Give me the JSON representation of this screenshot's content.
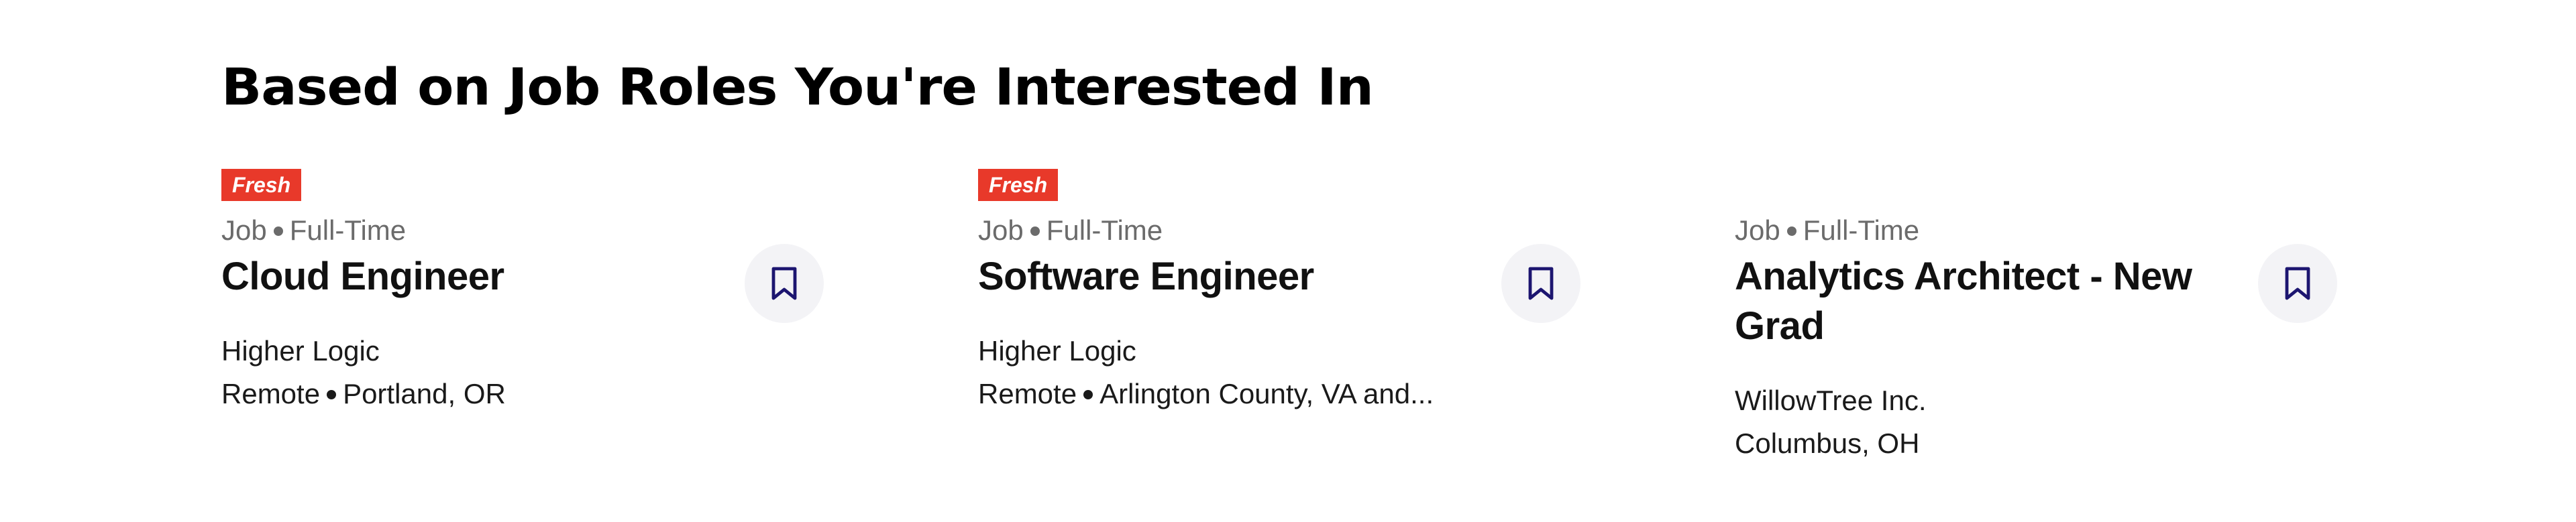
{
  "section": {
    "title": "Based on Job Roles You're Interested In"
  },
  "colors": {
    "badge_bg": "#e8392a",
    "bookmark_icon": "#1c1570",
    "save_button_bg": "#f3f3f6"
  },
  "icons": {
    "save": "bookmark-icon"
  },
  "jobs": [
    {
      "badge": "Fresh",
      "type": "Job",
      "schedule": "Full-Time",
      "title": "Cloud Engineer",
      "company": "Higher Logic",
      "location_mode": "Remote",
      "location": "Portland, OR"
    },
    {
      "badge": "Fresh",
      "type": "Job",
      "schedule": "Full-Time",
      "title": "Software Engineer",
      "company": "Higher Logic",
      "location_mode": "Remote",
      "location": "Arlington County, VA and..."
    },
    {
      "type": "Job",
      "schedule": "Full-Time",
      "title": "Analytics Architect - New Grad",
      "company": "WillowTree Inc.",
      "location": "Columbus, OH"
    }
  ]
}
